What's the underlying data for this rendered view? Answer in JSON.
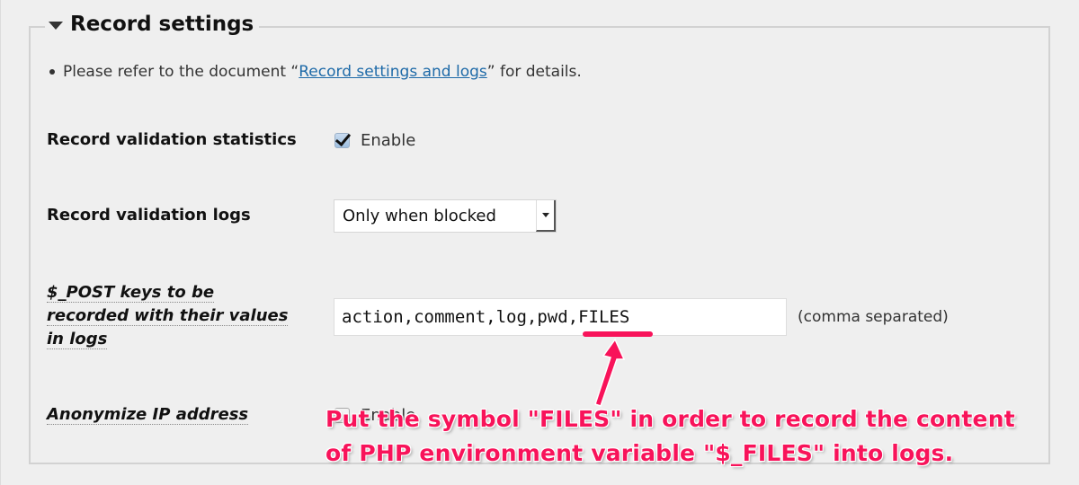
{
  "section": {
    "title": "Record settings",
    "collapse_icon": "triangle-down-icon"
  },
  "note": {
    "prefix": "Please refer to the document “",
    "link_text": "Record settings and logs",
    "suffix": "” for details.",
    "link_color": "#1e6aa8"
  },
  "fields": {
    "validation_statistics": {
      "label": "Record validation statistics",
      "checkbox_label": "Enable",
      "checked": true
    },
    "validation_logs": {
      "label": "Record validation logs",
      "selected": "Only when blocked"
    },
    "post_keys": {
      "label_lines": [
        "$_POST keys to be",
        "recorded with their values",
        "in logs"
      ],
      "value": "action,comment,log,pwd,FILES",
      "hint": "(comma separated)"
    },
    "anonymize_ip": {
      "label": "Anonymize IP address",
      "checkbox_label": "Enable",
      "checked": false
    }
  },
  "annotation": {
    "lines": [
      "Put the symbol \"FILES\" in order to record the content",
      "of PHP environment variable \"$_FILES\" into logs."
    ],
    "color": "#f8135a"
  }
}
